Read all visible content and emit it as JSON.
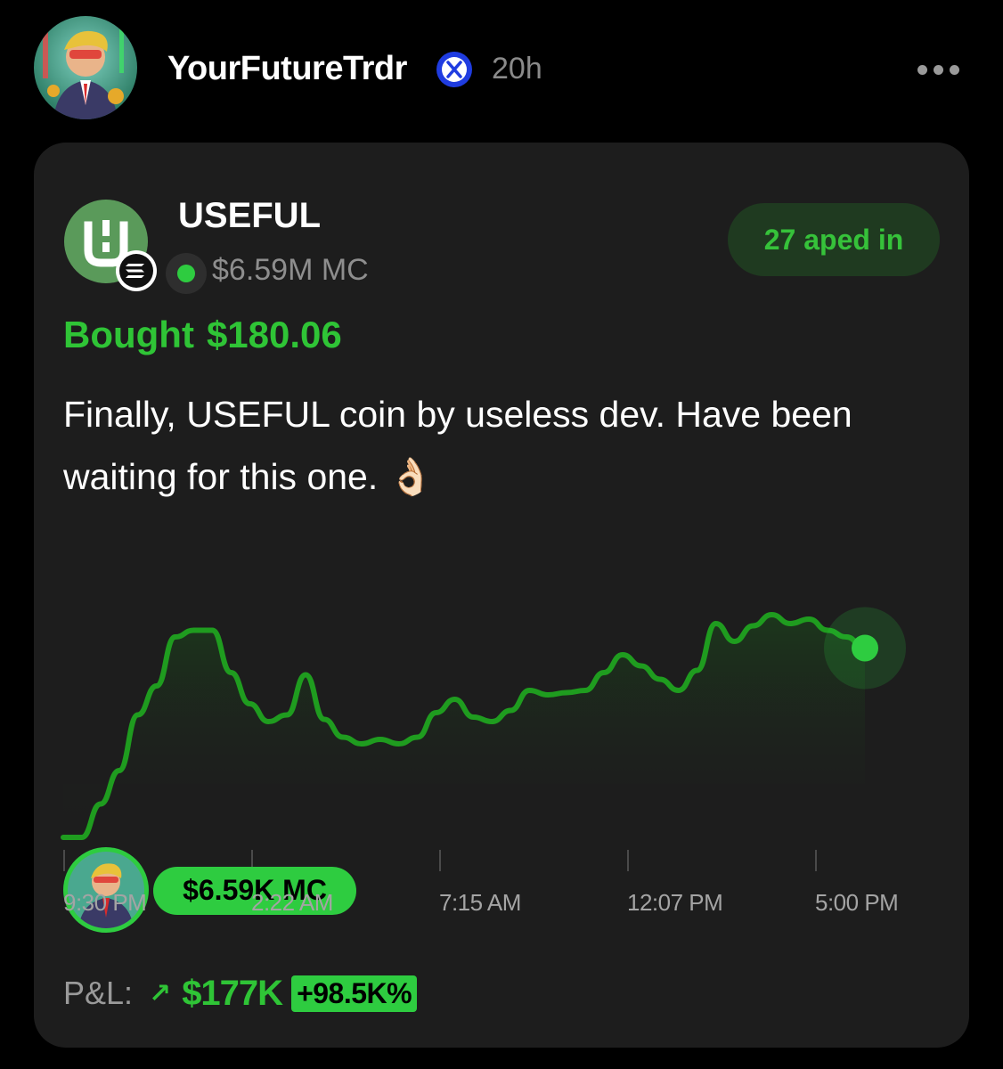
{
  "post": {
    "username": "YourFutureTrdr",
    "verified_icon": "x-logo-badge",
    "timestamp": "20h",
    "more_icon": "more-dots-icon"
  },
  "token": {
    "name": "USEFUL",
    "market_cap": "$6.59M MC",
    "aped_in": "27 aped in",
    "bought_label": "Bought",
    "bought_amount": "$180.06",
    "chain_icon": "solana-icon"
  },
  "text": {
    "line1": "Finally, USEFUL coin by useless dev. Have been",
    "line2": "waiting for this one. 👌🏻"
  },
  "chart": {
    "entry_label": "$6.59K MC",
    "time_labels": [
      "9:30 PM",
      "2:22 AM",
      "7:15 AM",
      "12:07 PM",
      "5:00 PM"
    ]
  },
  "chart_data": {
    "type": "line",
    "x": [
      "9:30 PM",
      "2:22 AM",
      "7:15 AM",
      "12:07 PM",
      "5:00 PM"
    ],
    "series": [
      {
        "values": [
          0,
          0,
          0.15,
          0.3,
          0.55,
          0.68,
          0.9,
          0.93,
          0.93,
          0.74,
          0.6,
          0.52,
          0.55,
          0.73,
          0.53,
          0.45,
          0.42,
          0.44,
          0.42,
          0.45,
          0.56,
          0.62,
          0.54,
          0.52,
          0.57,
          0.66,
          0.64,
          0.65,
          0.66,
          0.74,
          0.82,
          0.77,
          0.71,
          0.66,
          0.75,
          0.96,
          0.88,
          0.95,
          1.0,
          0.96,
          0.98,
          0.93,
          0.9,
          0.85
        ]
      }
    ],
    "accent_color": "#2ecc40"
  },
  "pnl": {
    "label": "P&L:",
    "arrow": "↗",
    "value": "$177K",
    "percent": "+98.5K%"
  }
}
